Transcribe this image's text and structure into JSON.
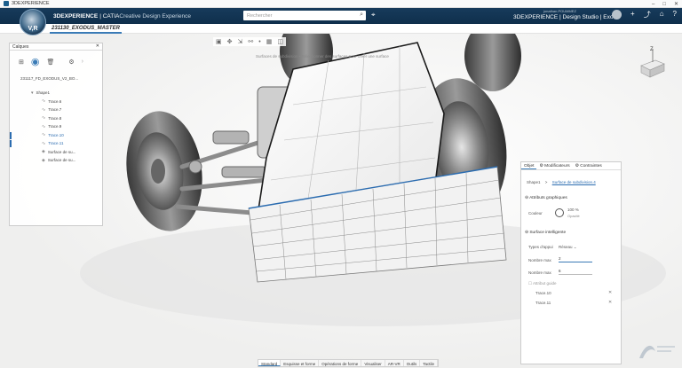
{
  "window": {
    "title": "3DEXPERIENCE",
    "controls": [
      "–",
      "□",
      "✕"
    ]
  },
  "topbar": {
    "compass_label": "V,R",
    "brand_bold": "3DEXPERIENCE",
    "brand_sep": " | CATIA ",
    "brand_light": "Creative Design Experience",
    "search_placeholder": "Rechercher",
    "user_name": "jonathan.POUMMEZ",
    "app_name": "3DEXPERIENCE | Design Studio | Exo...",
    "icons": [
      "avatar",
      "plus-icon",
      "share-icon",
      "home-icon",
      "help-icon"
    ]
  },
  "tab": {
    "label": "231130_EXODUS_MASTER"
  },
  "viewport": {
    "hint": "Surfaces de subdivision • Sélectionner des surfaces pour créer une surface",
    "compass_axis": "Z"
  },
  "layers_panel": {
    "title": "Calques",
    "file": "231117_FD_EXODUS_V2_BO...",
    "tree": [
      {
        "label": "Shape1",
        "indent": 0,
        "icon": "shape-icon",
        "selected": false
      },
      {
        "label": "Trace.6",
        "indent": 1,
        "icon": "trace-icon",
        "selected": false
      },
      {
        "label": "Trace.7",
        "indent": 1,
        "icon": "trace-icon",
        "selected": false
      },
      {
        "label": "Trace.8",
        "indent": 1,
        "icon": "trace-icon",
        "selected": false
      },
      {
        "label": "Trace.9",
        "indent": 1,
        "icon": "trace-icon",
        "selected": false
      },
      {
        "label": "Trace.10",
        "indent": 1,
        "icon": "trace-icon",
        "selected": true
      },
      {
        "label": "Trace.11",
        "indent": 1,
        "icon": "trace-icon",
        "selected": true
      },
      {
        "label": "Surface de su...",
        "indent": 1,
        "icon": "surface-icon",
        "selected": false
      },
      {
        "label": "Surface de su...",
        "indent": 1,
        "icon": "surface-icon",
        "selected": false
      }
    ]
  },
  "properties": {
    "tabs": [
      "Objet",
      "Modificateurs",
      "Contraintes"
    ],
    "breadcrumb_root": "Shape1",
    "breadcrumb_sep": ">",
    "breadcrumb_leaf": "Surface de subdivision.4",
    "graphics_section": "Attributs graphiques",
    "color_label": "Couleur",
    "opacity_value": "100 %",
    "opacity_label": "Opacité",
    "smart_section": "Surface intelligente",
    "type_label": "Types d'appui",
    "type_value": "Réseau",
    "nmax_label": "Nombre max",
    "nmax_value": "2",
    "nmin_label": "Nombre max",
    "nmin_value": "6",
    "guide_label": "Attribut guide",
    "traces": [
      "Trace.10",
      "Trace.11"
    ]
  },
  "bottom_tabs": [
    "Standard",
    "Esquisse et forme",
    "Opérations de forme",
    "Visualiser",
    "AR-VR",
    "Outils",
    "Tactile"
  ],
  "colors": {
    "topbar": "#173b5b",
    "accent": "#3a7bb6"
  }
}
